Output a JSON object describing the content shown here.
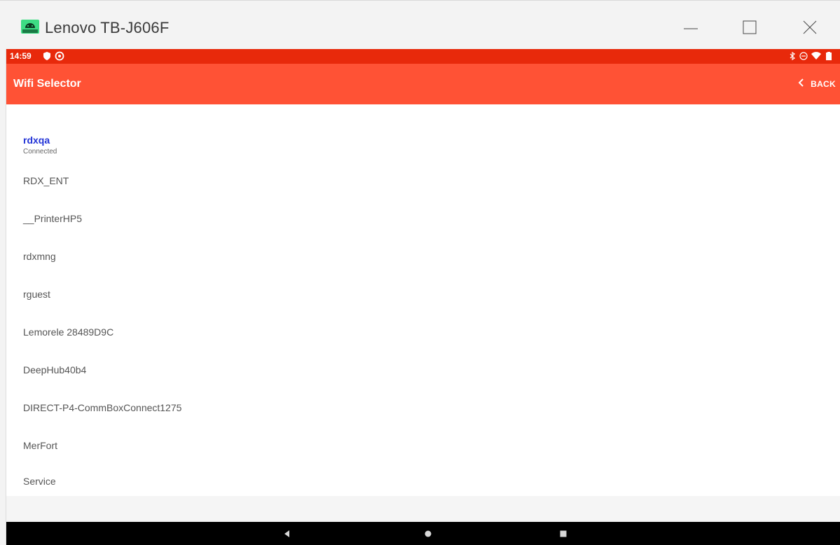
{
  "window": {
    "title": "Lenovo TB-J606F",
    "icons": {
      "app": "android-icon",
      "minimize": "minimize-icon",
      "maximize": "maximize-icon",
      "close": "close-icon"
    }
  },
  "status_bar": {
    "time": "14:59",
    "background": "#e8290b",
    "left_icons": [
      "shield-icon",
      "sync-icon"
    ],
    "right_icons": [
      "bluetooth-icon",
      "do-not-disturb-icon",
      "wifi-icon",
      "battery-icon"
    ]
  },
  "app_bar": {
    "title": "Wifi Selector",
    "back_label": "BACK",
    "background": "#ff5235"
  },
  "networks": [
    {
      "name": "rdxqa",
      "status": "Connected",
      "active": true
    },
    {
      "name": "RDX_ENT"
    },
    {
      "name": "__PrinterHP5"
    },
    {
      "name": "rdxmng"
    },
    {
      "name": "rguest"
    },
    {
      "name": "Lemorele 28489D9C"
    },
    {
      "name": "DeepHub40b4"
    },
    {
      "name": "DIRECT-P4-CommBoxConnect1275"
    },
    {
      "name": "MerFort"
    },
    {
      "name": "Service"
    }
  ],
  "colors": {
    "active_network": "#2233d6",
    "network_text": "#555555"
  },
  "nav_bar": {
    "buttons": [
      "back-triangle-icon",
      "home-circle-icon",
      "recents-square-icon"
    ]
  }
}
